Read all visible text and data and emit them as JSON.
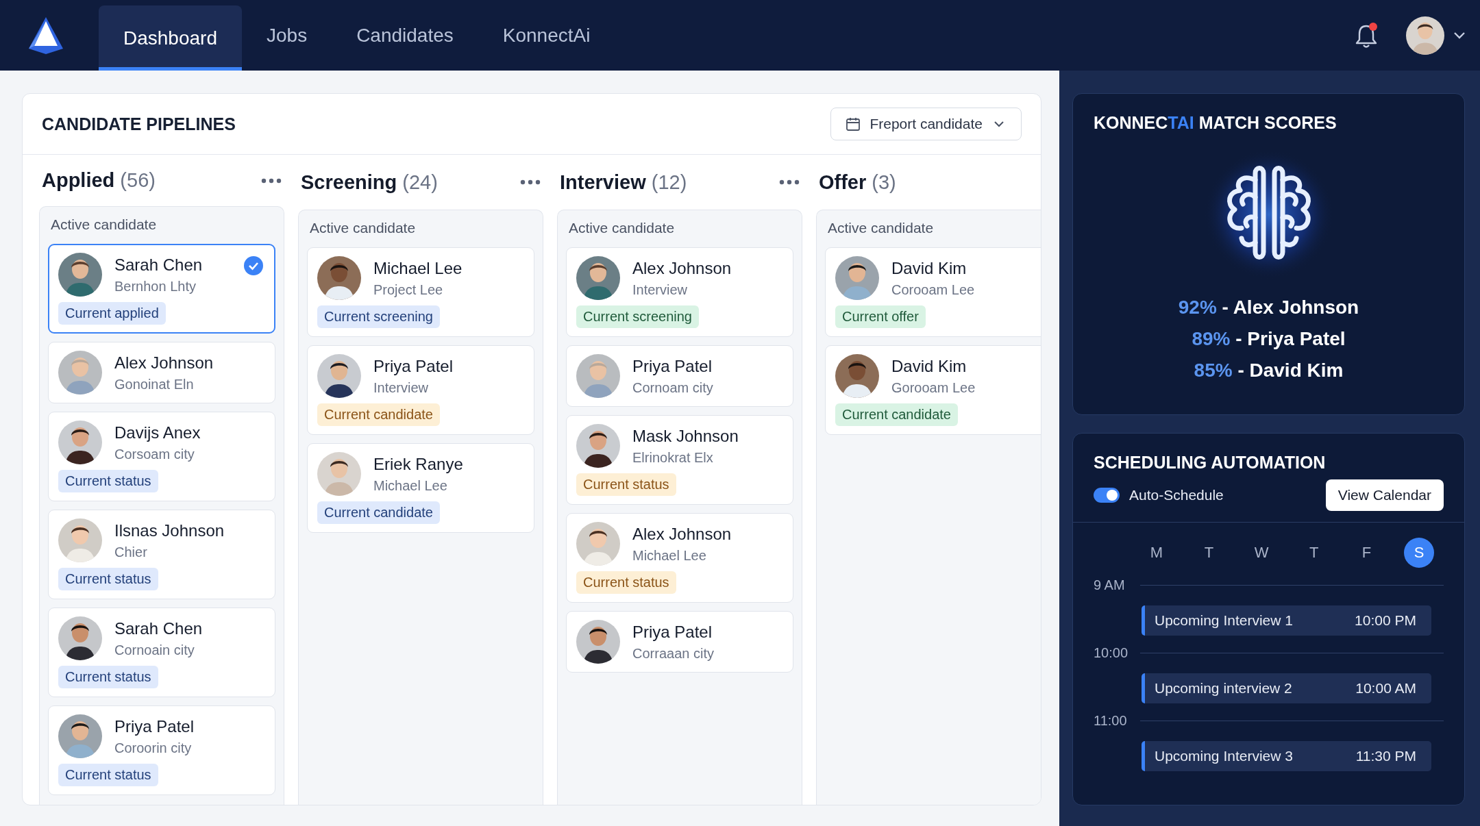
{
  "nav": {
    "tabs": [
      {
        "label": "Dashboard",
        "selected": true
      },
      {
        "label": "Jobs",
        "selected": false
      },
      {
        "label": "Candidates",
        "selected": false
      },
      {
        "label": "KonnectAi",
        "selected": false
      }
    ],
    "has_unread": true
  },
  "pipelines": {
    "title": "CANDIDATE PIPELINES",
    "action": {
      "label": "Freport candidate"
    },
    "columns": [
      {
        "title": "Applied",
        "count": "(56)",
        "has_menu": true,
        "group_label": "Active candidate",
        "cards": [
          {
            "name": "Sarah Chen",
            "subtitle": "Bernhon Lhty",
            "badge": {
              "label": "Current applied",
              "color": "#dfe9fc"
            },
            "selected": true
          },
          {
            "name": "Alex Johnson",
            "subtitle": "Gonoinat Eln",
            "selected": false
          },
          {
            "name": "Davijs Anex",
            "subtitle": "Corsoam city",
            "badge": {
              "label": "Current status",
              "color": "#dfe9fc"
            },
            "selected": false
          },
          {
            "name": "Ilsnas Johnson",
            "subtitle": "Chier",
            "badge": {
              "label": "Current status",
              "color": "#dfe9fc"
            },
            "selected": false
          },
          {
            "name": "Sarah Chen",
            "subtitle": "Cornoain city",
            "badge": {
              "label": "Current status",
              "color": "#dfe9fc"
            },
            "selected": false
          },
          {
            "name": "Priya Patel",
            "subtitle": "Coroorin city",
            "badge": {
              "label": "Current status",
              "color": "#dfe9fc"
            },
            "selected": false
          }
        ]
      },
      {
        "title": "Screening",
        "count": "(24)",
        "has_menu": true,
        "group_label": "Active candidate",
        "cards": [
          {
            "name": "Michael Lee",
            "subtitle": "Project Lee",
            "badge": {
              "label": "Current screening",
              "color": "#dfe9fc"
            },
            "selected": false
          },
          {
            "name": "Priya Patel",
            "subtitle": "Interview",
            "badge": {
              "label": "Current candidate",
              "color": "#fdefd5"
            },
            "selected": false
          },
          {
            "name": "Eriek Ranye",
            "subtitle": "Michael Lee",
            "badge": {
              "label": "Current candidate",
              "color": "#dfe9fc"
            },
            "selected": false
          }
        ]
      },
      {
        "title": "Interview",
        "count": "(12)",
        "has_menu": true,
        "group_label": "Active candidate",
        "cards": [
          {
            "name": "Alex Johnson",
            "subtitle": "Interview",
            "badge": {
              "label": "Current screening",
              "color": "#d9f3e4"
            },
            "selected": false
          },
          {
            "name": "Priya Patel",
            "subtitle": "Cornoam city",
            "selected": false
          },
          {
            "name": "Mask Johnson",
            "subtitle": "Elrinokrat Elx",
            "badge": {
              "label": "Current status",
              "color": "#fdefd5"
            },
            "selected": false
          },
          {
            "name": "Alex Johnson",
            "subtitle": "Michael Lee",
            "badge": {
              "label": "Current status",
              "color": "#fdefd5"
            },
            "selected": false
          },
          {
            "name": "Priya Patel",
            "subtitle": "Corraaan city",
            "selected": false
          }
        ]
      },
      {
        "title": "Offer",
        "count": "(3)",
        "has_menu": false,
        "group_label": "Active candidate",
        "cards": [
          {
            "name": "David Kim",
            "subtitle": "Corooam Lee",
            "badge": {
              "label": "Current offer",
              "color": "#d9f3e4"
            },
            "selected": false
          },
          {
            "name": "David Kim",
            "subtitle": "Gorooam Lee",
            "badge": {
              "label": "Current candidate",
              "color": "#d9f3e4"
            },
            "selected": false
          }
        ]
      }
    ]
  },
  "match_scores": {
    "title": {
      "prefix": "KONNEC",
      "highlight": "TAI",
      "suffix": " MATCH SCORES"
    },
    "scores": [
      {
        "score": "92%",
        "label": "- Alex Johnson"
      },
      {
        "score": "89%",
        "label": "- Priya Patel"
      },
      {
        "score": "85%",
        "label": "- David Kim"
      }
    ]
  },
  "scheduling": {
    "title": "SCHEDULING AUTOMATION",
    "toggle": {
      "label": "Auto-Schedule",
      "on": true
    },
    "button": "View Calendar",
    "days": [
      {
        "label": "M",
        "selected": false
      },
      {
        "label": "T",
        "selected": false
      },
      {
        "label": "W",
        "selected": false
      },
      {
        "label": "T",
        "selected": false
      },
      {
        "label": "F",
        "selected": false
      },
      {
        "label": "S",
        "selected": true
      }
    ],
    "slots": [
      {
        "time": "9 AM",
        "event": {
          "title": "Upcoming Interview 1",
          "time": "10:00 PM"
        }
      },
      {
        "time": "10:00",
        "event": {
          "title": "Upcoming interview 2",
          "time": "10:00 AM"
        }
      },
      {
        "time": "11:00",
        "event": {
          "title": "Upcoming Interview 3",
          "time": "11:30 PM"
        }
      }
    ]
  }
}
